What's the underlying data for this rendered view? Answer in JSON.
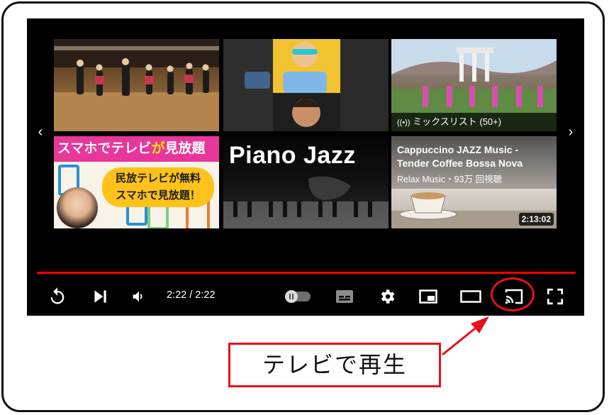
{
  "end_screen": {
    "tiles": [
      {
        "id": "dance-video",
        "label": ""
      },
      {
        "id": "reaction-video",
        "label": ""
      },
      {
        "id": "hula-mix",
        "mix_label": "ミックスリスト (50+)"
      },
      {
        "id": "smartphone-tv",
        "banner_prefix": "スマホでテレビ",
        "banner_particle": "が",
        "banner_suffix": "見放題",
        "bubble_line1": "民放テレビが無料",
        "bubble_line2": "スマホで見放題！"
      },
      {
        "id": "piano-jazz",
        "title": "Piano Jazz"
      },
      {
        "id": "cappuccino-jazz",
        "title": "Cappuccino JAZZ Music - Tender Coffee Bossa Nova",
        "channel_views": "Relax Music・93万 回視聴",
        "duration": "2:13:02"
      }
    ],
    "prev_arrow": "‹",
    "next_arrow": "›"
  },
  "controls": {
    "time_display": "2:22 / 2:22",
    "progress_fraction": 1.0
  },
  "callout": {
    "label": "テレビで再生"
  },
  "colors": {
    "accent_red": "#e8101a",
    "progress_red": "#ff0000",
    "player_bg": "#000000"
  }
}
